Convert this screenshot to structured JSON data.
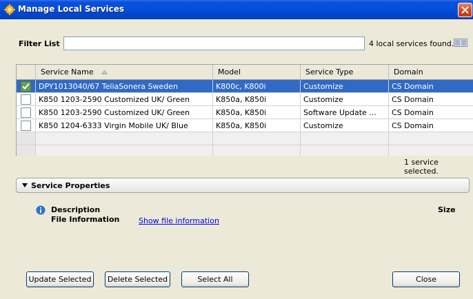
{
  "window": {
    "title": "Manage Local Services",
    "app_icon": "services-gear-icon",
    "close_icon": "close-x-icon"
  },
  "filter": {
    "label": "Filter List",
    "value": "",
    "found_text": "4 local services found.",
    "view_icon": "list-view-icon"
  },
  "table": {
    "headers": [
      "Service Name",
      "Model",
      "Service Type",
      "Domain"
    ],
    "sort_icon": "sort-ascending-icon",
    "rows": [
      {
        "checked": true,
        "selected": true,
        "name": "DPY1013040/67 TeliaSonera Sweden",
        "model": "K800c, K800i",
        "type": "Customize",
        "domain": "CS Domain"
      },
      {
        "checked": false,
        "selected": false,
        "name": "K850 1203-2590 Customized UK/ Green",
        "model": "K850a, K850i",
        "type": "Customize",
        "domain": "CS Domain"
      },
      {
        "checked": false,
        "selected": false,
        "name": "K850 1203-2590 Customized UK/ Green",
        "model": "K850a, K850i",
        "type": "Software Update ...",
        "domain": "CS Domain"
      },
      {
        "checked": false,
        "selected": false,
        "name": "K850 1204-6333 Virgin Mobile UK/ Blue",
        "model": "K850a, K850i",
        "type": "Customize",
        "domain": "CS Domain"
      }
    ],
    "selected_count": "1 service selected."
  },
  "properties": {
    "header": "Service Properties",
    "description_label": "Description",
    "file_info_label": "File Information",
    "file_info_link": "Show file information",
    "size_label": "Size",
    "info_icon": "info-icon"
  },
  "buttons": {
    "update": "Update Selected",
    "delete": "Delete Selected",
    "select_all": "Select All",
    "close": "Close"
  },
  "colors": {
    "titlebar": "#0550d9",
    "selection": "#316ac5",
    "background": "#ece9d8",
    "link": "#0000ee"
  }
}
